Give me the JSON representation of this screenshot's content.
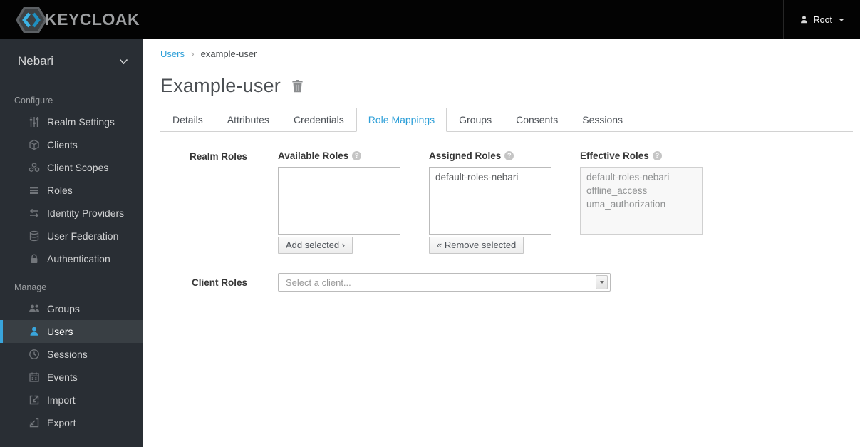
{
  "header": {
    "logo_text": "KEYCLOAK",
    "user": {
      "name": "Root"
    }
  },
  "sidebar": {
    "realm": "Nebari",
    "sections": [
      {
        "label": "Configure",
        "items": [
          {
            "label": "Realm Settings",
            "icon": "sliders-icon"
          },
          {
            "label": "Clients",
            "icon": "cube-icon"
          },
          {
            "label": "Client Scopes",
            "icon": "cubes-icon"
          },
          {
            "label": "Roles",
            "icon": "list-icon"
          },
          {
            "label": "Identity Providers",
            "icon": "exchange-icon"
          },
          {
            "label": "User Federation",
            "icon": "database-icon"
          },
          {
            "label": "Authentication",
            "icon": "lock-icon"
          }
        ]
      },
      {
        "label": "Manage",
        "items": [
          {
            "label": "Groups",
            "icon": "users-icon"
          },
          {
            "label": "Users",
            "icon": "user-icon",
            "active": true
          },
          {
            "label": "Sessions",
            "icon": "clock-icon"
          },
          {
            "label": "Events",
            "icon": "calendar-icon"
          },
          {
            "label": "Import",
            "icon": "import-icon"
          },
          {
            "label": "Export",
            "icon": "export-icon"
          }
        ]
      }
    ]
  },
  "breadcrumb": {
    "link": "Users",
    "current": "example-user"
  },
  "page": {
    "title": "Example-user"
  },
  "tabs": [
    {
      "label": "Details"
    },
    {
      "label": "Attributes"
    },
    {
      "label": "Credentials"
    },
    {
      "label": "Role Mappings",
      "active": true
    },
    {
      "label": "Groups"
    },
    {
      "label": "Consents"
    },
    {
      "label": "Sessions"
    }
  ],
  "form": {
    "realm_roles": {
      "label": "Realm Roles",
      "available": {
        "heading": "Available Roles",
        "items": [],
        "button_label": "Add selected ›"
      },
      "assigned": {
        "heading": "Assigned Roles",
        "items": [
          "default-roles-nebari"
        ],
        "button_label": "« Remove selected"
      },
      "effective": {
        "heading": "Effective Roles",
        "items": [
          "default-roles-nebari",
          "offline_access",
          "uma_authorization"
        ]
      }
    },
    "client_roles": {
      "label": "Client Roles",
      "placeholder": "Select a client..."
    }
  },
  "colors": {
    "accent_blue": "#2d9fd8",
    "active_border_blue": "#39a5dc",
    "sidebar_bg": "#292e34",
    "sidebar_active_bg": "#393f44",
    "header_bg": "#030303"
  }
}
